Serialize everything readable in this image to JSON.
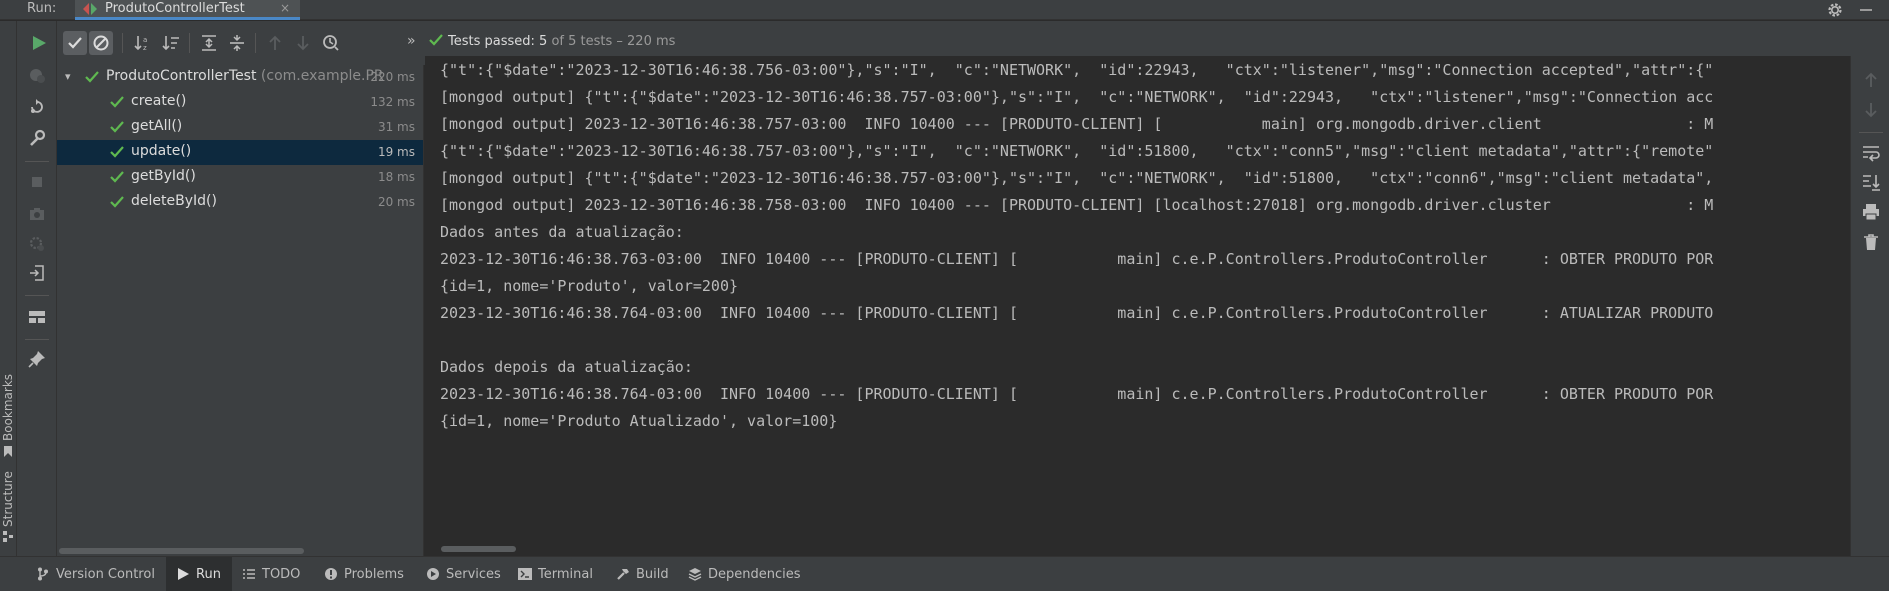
{
  "run_window": {
    "label": "Run:",
    "tab_title": "ProdutoControllerTest",
    "tab_close": "×"
  },
  "status": {
    "prefix": "Tests passed:",
    "passed": "5",
    "suffix": "of 5 tests – 220 ms"
  },
  "tree": {
    "root": {
      "name": "ProdutoControllerTest",
      "package": "(com.example.PR",
      "duration": "220 ms"
    },
    "tests": [
      {
        "name": "create()",
        "duration": "132 ms"
      },
      {
        "name": "getAll()",
        "duration": "31 ms"
      },
      {
        "name": "update()",
        "duration": "19 ms"
      },
      {
        "name": "getById()",
        "duration": "18 ms"
      },
      {
        "name": "deleteById()",
        "duration": "20 ms"
      }
    ]
  },
  "console": {
    "lines": [
      "{\"t\":{\"$date\":\"2023-12-30T16:46:38.756-03:00\"},\"s\":\"I\",  \"c\":\"NETWORK\",  \"id\":22943,   \"ctx\":\"listener\",\"msg\":\"Connection accepted\",\"attr\":{\"",
      "[mongod output] {\"t\":{\"$date\":\"2023-12-30T16:46:38.757-03:00\"},\"s\":\"I\",  \"c\":\"NETWORK\",  \"id\":22943,   \"ctx\":\"listener\",\"msg\":\"Connection acc",
      "[mongod output] 2023-12-30T16:46:38.757-03:00  INFO 10400 --- [PRODUTO-CLIENT] [           main] org.mongodb.driver.client                : M",
      "{\"t\":{\"$date\":\"2023-12-30T16:46:38.757-03:00\"},\"s\":\"I\",  \"c\":\"NETWORK\",  \"id\":51800,   \"ctx\":\"conn5\",\"msg\":\"client metadata\",\"attr\":{\"remote\"",
      "[mongod output] {\"t\":{\"$date\":\"2023-12-30T16:46:38.757-03:00\"},\"s\":\"I\",  \"c\":\"NETWORK\",  \"id\":51800,   \"ctx\":\"conn6\",\"msg\":\"client metadata\",",
      "[mongod output] 2023-12-30T16:46:38.758-03:00  INFO 10400 --- [PRODUTO-CLIENT] [localhost:27018] org.mongodb.driver.cluster               : M",
      "Dados antes da atualização:",
      "2023-12-30T16:46:38.763-03:00  INFO 10400 --- [PRODUTO-CLIENT] [           main] c.e.P.Controllers.ProdutoController      : OBTER PRODUTO POR",
      "{id=1, nome='Produto', valor=200}",
      "2023-12-30T16:46:38.764-03:00  INFO 10400 --- [PRODUTO-CLIENT] [           main] c.e.P.Controllers.ProdutoController      : ATUALIZAR PRODUTO",
      "",
      "Dados depois da atualização:",
      "2023-12-30T16:46:38.764-03:00  INFO 10400 --- [PRODUTO-CLIENT] [           main] c.e.P.Controllers.ProdutoController      : OBTER PRODUTO POR",
      "{id=1, nome='Produto Atualizado', valor=100}"
    ]
  },
  "side_tabs": {
    "bookmarks": "Bookmarks",
    "structure": "Structure"
  },
  "bottom_tabs": [
    {
      "label": "Version Control",
      "icon": "branch-icon"
    },
    {
      "label": "Run",
      "icon": "play-icon"
    },
    {
      "label": "TODO",
      "icon": "list-icon"
    },
    {
      "label": "Problems",
      "icon": "info-icon"
    },
    {
      "label": "Services",
      "icon": "services-icon"
    },
    {
      "label": "Terminal",
      "icon": "terminal-icon"
    },
    {
      "label": "Build",
      "icon": "hammer-icon"
    },
    {
      "label": "Dependencies",
      "icon": "dependencies-icon"
    }
  ],
  "colors": {
    "pass_green": "#5fb950",
    "play_green": "#59a869",
    "selection": "#0d293e",
    "panel": "#3c3f41",
    "editor": "#2b2b2b"
  }
}
